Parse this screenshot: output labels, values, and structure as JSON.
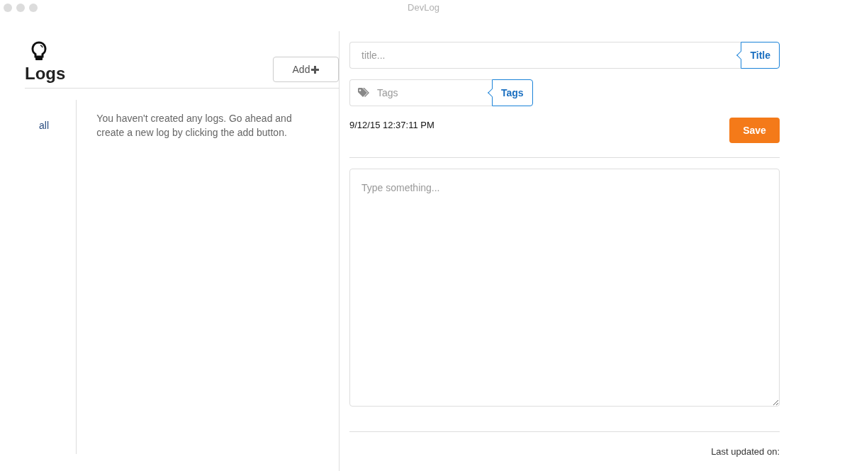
{
  "window": {
    "title": "DevLog"
  },
  "logs": {
    "title": "Logs",
    "add_button": "Add",
    "sidebar": {
      "items": [
        {
          "label": "all"
        }
      ]
    },
    "empty_message": "You haven't created any logs. Go ahead and create a new log by clicking the add button."
  },
  "editor": {
    "title_field": {
      "placeholder": "title...",
      "label": "Title"
    },
    "tags_field": {
      "placeholder": "Tags",
      "label": "Tags"
    },
    "timestamp": "9/12/15 12:37:11 PM",
    "save_button": "Save",
    "body": {
      "placeholder": "Type something..."
    },
    "last_updated": "Last updated on:"
  }
}
